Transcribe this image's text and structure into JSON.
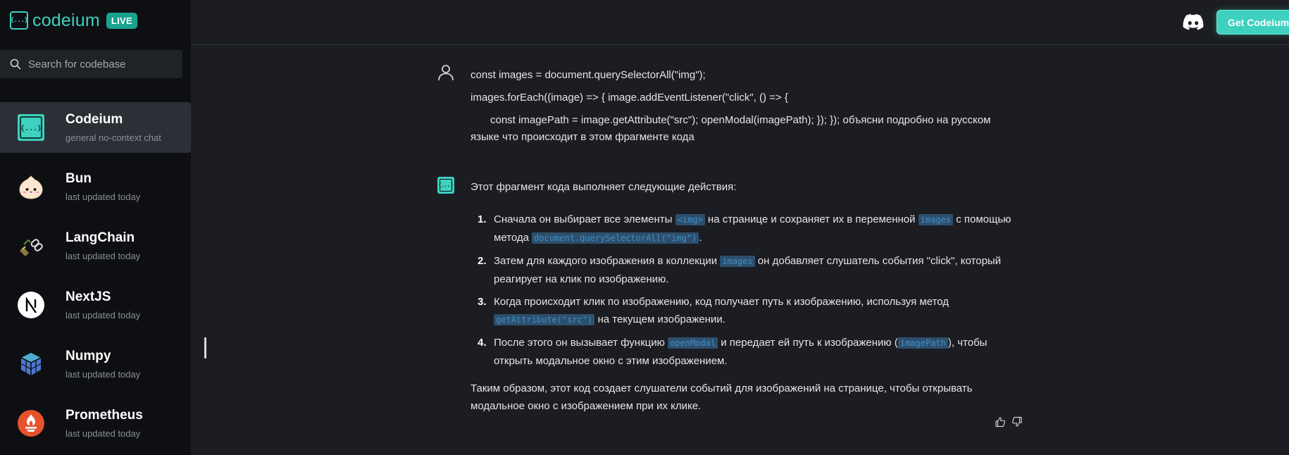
{
  "brand": {
    "name": "codeium",
    "badge": "LIVE",
    "logo_glyph": "{...}"
  },
  "search": {
    "placeholder": "Search for codebase",
    "value": ""
  },
  "knowledge_bases": [
    {
      "name": "Codeium",
      "subtitle": "general no-context chat",
      "icon": "codeium-logo-icon",
      "active": true
    },
    {
      "name": "Bun",
      "subtitle": "last updated today",
      "icon": "bun-icon",
      "active": false
    },
    {
      "name": "LangChain",
      "subtitle": "last updated today",
      "icon": "langchain-icon",
      "active": false
    },
    {
      "name": "NextJS",
      "subtitle": "last updated today",
      "icon": "nextjs-icon",
      "active": false
    },
    {
      "name": "Numpy",
      "subtitle": "last updated today",
      "icon": "numpy-icon",
      "active": false
    },
    {
      "name": "Prometheus",
      "subtitle": "last updated today",
      "icon": "prometheus-icon",
      "active": false
    }
  ],
  "header": {
    "discord_icon": "discord-icon",
    "cta_label": "Get Codeium"
  },
  "chat": {
    "user_message": {
      "line1": "const images = document.querySelectorAll(\"img\");",
      "line2": "images.forEach((image) => {     image.addEventListener(\"click\", () => {",
      "line3": "const imagePath = image.getAttribute(\"src\");        openModal(imagePath);     }); }); объясни подробно на русском языке что происходит в этом фрагменте кода"
    },
    "bot_message": {
      "intro": "Этот фрагмент кода выполняет следующие действия:",
      "items": [
        {
          "num": "1.",
          "t1": "Сначала он выбирает все элементы ",
          "c1": "<img>",
          "t2": " на странице и сохраняет их в переменной ",
          "c2": "images",
          "t3": " с помощью метода ",
          "c3": "document.querySelectorAll(\"img\")",
          "t4": "."
        },
        {
          "num": "2.",
          "t1": "Затем для каждого изображения в коллекции ",
          "c1": "images",
          "t2": " он добавляет слушатель события \"click\", который реагирует на клик по изображению."
        },
        {
          "num": "3.",
          "t1": "Когда происходит клик по изображению, код получает путь к изображению, используя метод ",
          "c1": "getAttribute(\"src\")",
          "t2": " на текущем изображении."
        },
        {
          "num": "4.",
          "t1": "После этого он вызывает функцию ",
          "c1": "openModal",
          "t2": " и передает ей путь к изображению (",
          "c2": "imagePath",
          "t3": "), чтобы открыть модальное окно с этим изображением."
        }
      ],
      "summary": "Таким образом, этот код создает слушатели событий для изображений на странице, чтобы открывать модальное окно с изображением при их клике."
    },
    "feedback": {
      "up_icon": "thumbs-up-icon",
      "down_icon": "thumbs-down-icon"
    }
  },
  "colors": {
    "accent": "#3fd1bf",
    "sidebar_bg": "#0d0f12",
    "main_bg": "#1b1d22",
    "code_bg": "#2d4f6e",
    "code_fg": "#3f8ec4"
  }
}
